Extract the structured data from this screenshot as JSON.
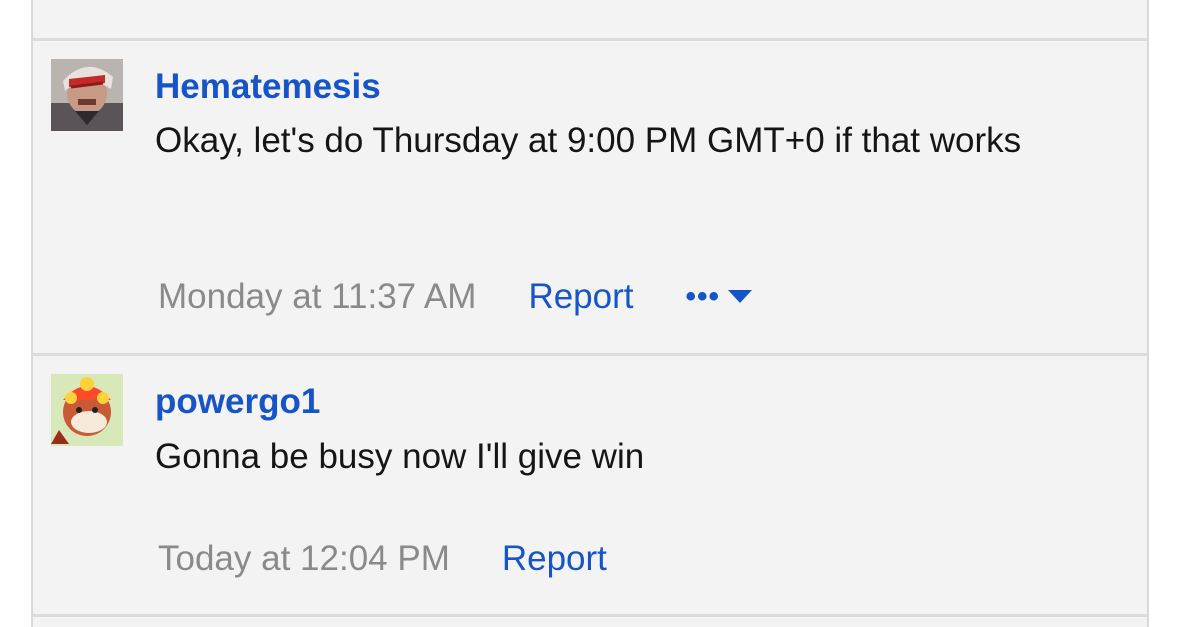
{
  "posts": [
    {
      "username": "Hematemesis",
      "avatar": "hematemesis-avatar",
      "text": "Okay, let's do Thursday at 9:00 PM GMT+0 if that works",
      "timestamp": "Monday at 11:37 AM",
      "report_label": "Report",
      "more_label": "•••"
    },
    {
      "username": "powergo1",
      "avatar": "powergo1-avatar",
      "text": "Gonna be busy now I'll give win",
      "timestamp": "Today at 12:04 PM",
      "report_label": "Report"
    }
  ],
  "icons": {
    "more": "dropdown-caret-icon"
  },
  "colors": {
    "link": "#1654c8",
    "timestamp": "#8a8a8a",
    "background": "#f3f3f3",
    "divider": "#dcdcdc"
  }
}
